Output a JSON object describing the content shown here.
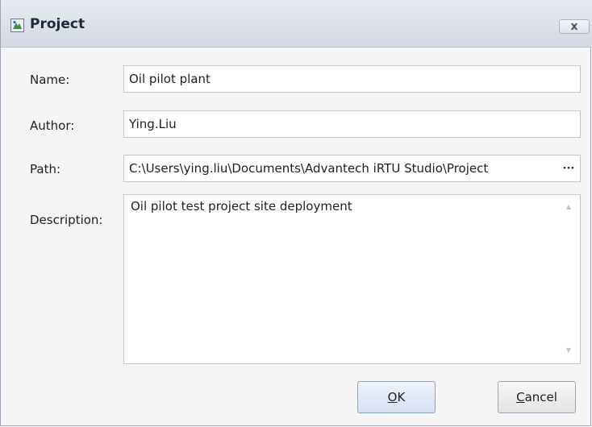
{
  "window": {
    "title": "Project",
    "close_glyph": "x",
    "icon": "project-app-icon"
  },
  "form": {
    "name": {
      "label": "Name:",
      "value": "Oil pilot plant"
    },
    "author": {
      "label": "Author:",
      "value": "Ying.Liu"
    },
    "path": {
      "label": "Path:",
      "value": "C:\\Users\\ying.liu\\Documents\\Advantech iRTU Studio\\Project",
      "browse_label": "···"
    },
    "description": {
      "label": "Description:",
      "value": "Oil pilot test project site deployment"
    }
  },
  "buttons": {
    "ok": {
      "mnemonic": "O",
      "rest": "K"
    },
    "cancel": {
      "mnemonic": "C",
      "rest": "ancel"
    }
  },
  "colors": {
    "titlebar": "#d3d9e2",
    "background": "#f5f5f5",
    "ok_button": "#d6e1f1"
  }
}
